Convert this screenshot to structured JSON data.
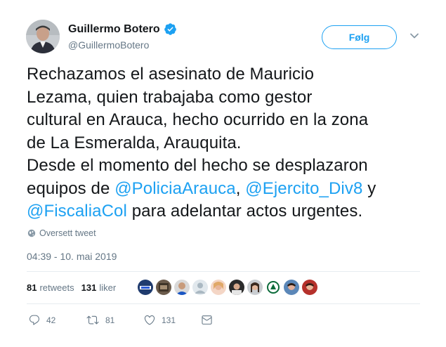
{
  "author": {
    "name": "Guillermo Botero",
    "handle": "@GuillermoBotero"
  },
  "follow_label": "Følg",
  "tweet": {
    "lines": [
      [
        {
          "t": "Rechazamos el asesinato de Mauricio"
        }
      ],
      [
        {
          "t": "Lezama, quien trabajaba como gestor"
        }
      ],
      [
        {
          "t": "cultural en Arauca, hecho ocurrido en la zona"
        }
      ],
      [
        {
          "t": "de La Esmeralda, Arauquita."
        }
      ],
      [
        {
          "t": "Desde el momento del hecho se desplazaron"
        }
      ],
      [
        {
          "t": "equipos de "
        },
        {
          "t": "@PoliciaArauca",
          "m": true
        },
        {
          "t": ", "
        },
        {
          "t": "@Ejercito_Div8",
          "m": true
        },
        {
          "t": " y"
        }
      ],
      [
        {
          "t": "@FiscaliaCol",
          "m": true
        },
        {
          "t": " para adelantar actos urgentes."
        }
      ]
    ]
  },
  "translate_label": "Oversett tweet",
  "timestamp": "04:39 - 10. mai 2019",
  "stats": {
    "retweets_count": "81",
    "retweets_label": "retweets",
    "likes_count": "131",
    "likes_label": "liker"
  },
  "liker_avatars": [
    "avatar-1",
    "avatar-2",
    "avatar-3",
    "avatar-4",
    "avatar-5",
    "avatar-6",
    "avatar-7",
    "avatar-8",
    "avatar-9",
    "avatar-10"
  ],
  "actions": {
    "reply_count": "42",
    "retweet_count": "81",
    "like_count": "131"
  },
  "colors": {
    "accent": "#1da1f2",
    "muted": "#657786",
    "text": "#14171a"
  }
}
